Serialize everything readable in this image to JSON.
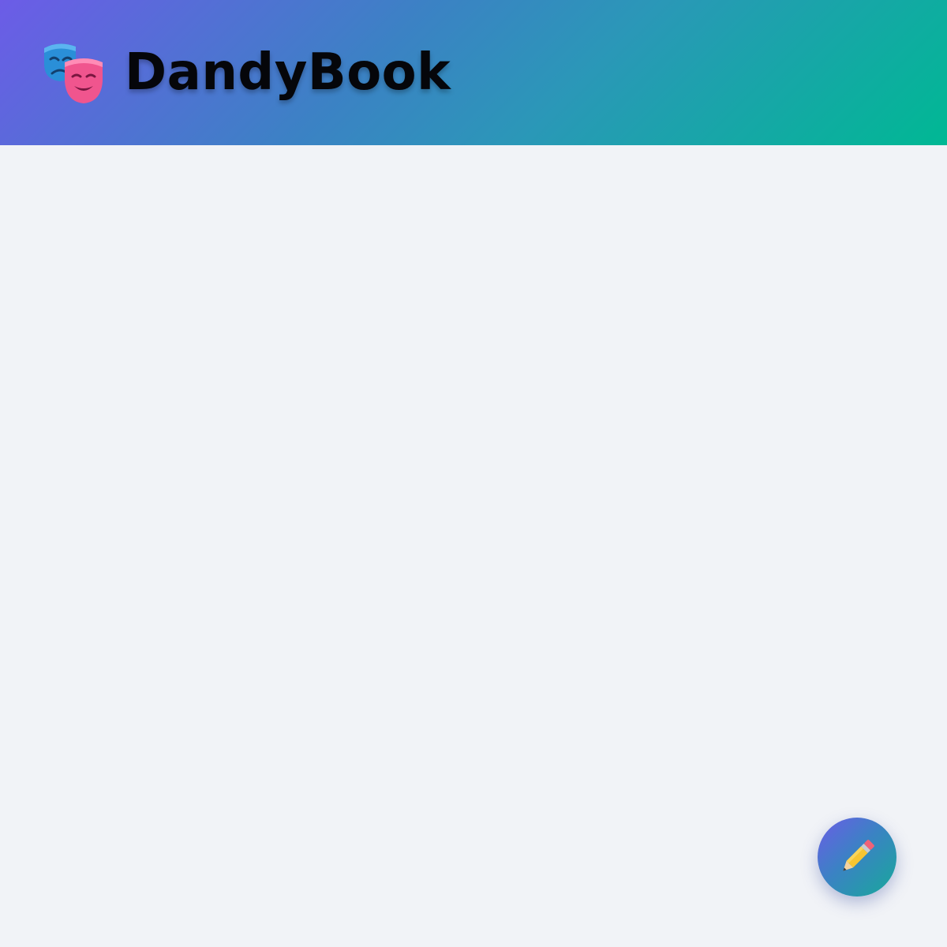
{
  "header": {
    "title": "DandyBook",
    "logo_icon": "theater-masks-icon",
    "gradient": [
      "#6c5ce7",
      "#00b894"
    ]
  },
  "fab": {
    "icon": "pencil-icon"
  },
  "colors": {
    "background": "#f1f3f7",
    "title_text": "#05060a"
  }
}
